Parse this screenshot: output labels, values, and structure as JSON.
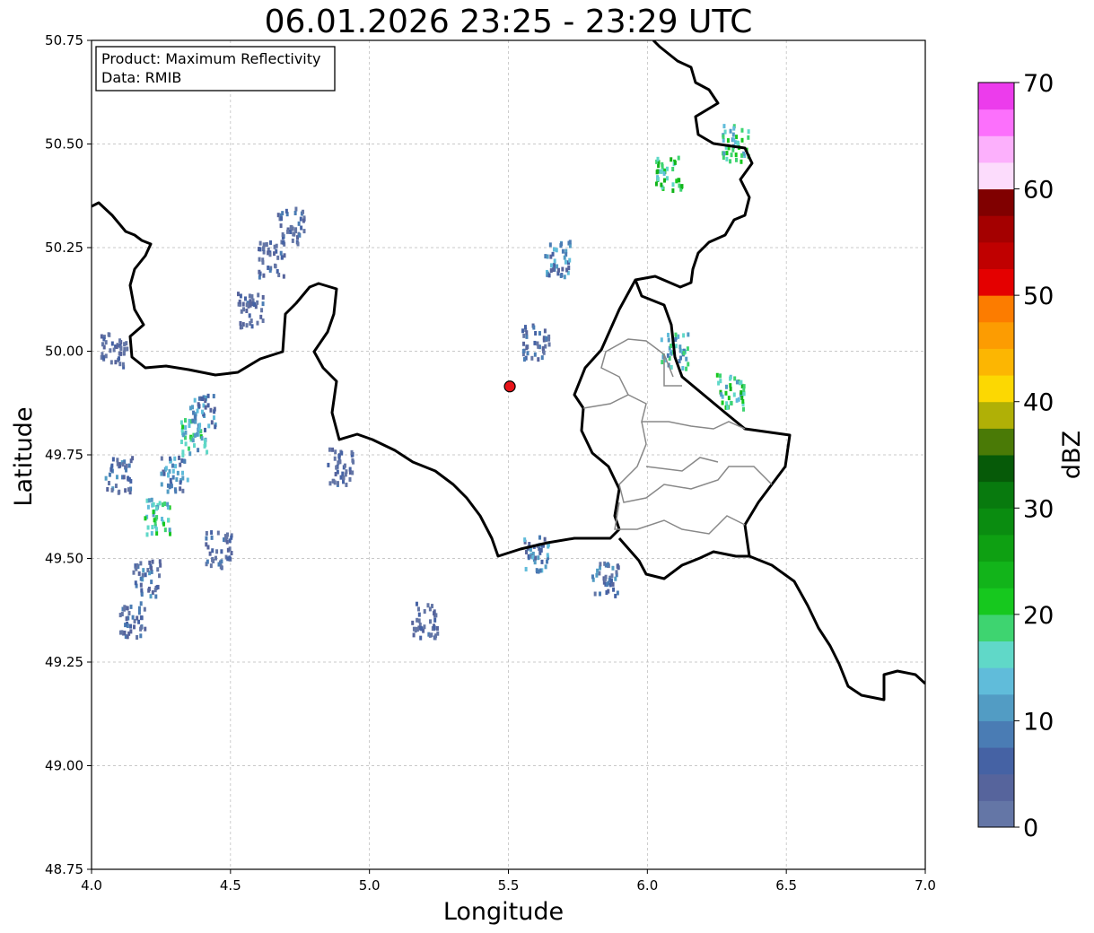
{
  "title": "06.01.2026 23:25 - 23:29 UTC",
  "info_box": {
    "product_line": "Product: Maximum Reflectivity",
    "data_line": "Data: RMIB"
  },
  "chart_data": {
    "type": "heatmap",
    "title": "06.01.2026 23:25 - 23:29 UTC",
    "xlabel": "Longitude",
    "ylabel": "Latitude",
    "xlim": [
      4.0,
      7.0
    ],
    "ylim": [
      48.75,
      50.75
    ],
    "x_ticks": [
      "4.0",
      "4.5",
      "5.0",
      "5.5",
      "6.0",
      "6.5",
      "7.0"
    ],
    "y_ticks": [
      "48.75",
      "49.00",
      "49.25",
      "49.50",
      "49.75",
      "50.00",
      "50.25",
      "50.50",
      "50.75"
    ],
    "grid": true,
    "radar_site": {
      "lon": 5.505,
      "lat": 49.915,
      "color": "#e8141a"
    },
    "colorbar": {
      "label": "dBZ",
      "min": 0,
      "max": 70,
      "ticks": [
        "0",
        "10",
        "20",
        "30",
        "40",
        "50",
        "60",
        "70"
      ],
      "colors": [
        "#6476a6",
        "#56649c",
        "#4562a4",
        "#4a7cb4",
        "#529cc4",
        "#60bcda",
        "#60d8c8",
        "#3ed470",
        "#16c81e",
        "#12b41a",
        "#0ea012",
        "#0a8c10",
        "#087a0e",
        "#065a08",
        "#4a7a06",
        "#b0b006",
        "#fcd802",
        "#fcb602",
        "#fc9c02",
        "#fc7c00",
        "#e40000",
        "#c00000",
        "#a40000",
        "#800000",
        "#fcdcfc",
        "#fcb0fc",
        "#fc70fc",
        "#ec3cec"
      ]
    },
    "echoes": [
      {
        "lon": 4.24,
        "lat": 49.6,
        "value": 22
      },
      {
        "lon": 4.37,
        "lat": 49.79,
        "value": 21
      },
      {
        "lon": 4.4,
        "lat": 49.85,
        "value": 15
      },
      {
        "lon": 4.3,
        "lat": 49.7,
        "value": 14
      },
      {
        "lon": 4.2,
        "lat": 49.45,
        "value": 12
      },
      {
        "lon": 4.15,
        "lat": 49.35,
        "value": 10
      },
      {
        "lon": 4.1,
        "lat": 49.7,
        "value": 11
      },
      {
        "lon": 4.46,
        "lat": 49.52,
        "value": 9
      },
      {
        "lon": 4.72,
        "lat": 50.3,
        "value": 9
      },
      {
        "lon": 4.65,
        "lat": 50.22,
        "value": 8
      },
      {
        "lon": 4.57,
        "lat": 50.1,
        "value": 8
      },
      {
        "lon": 5.6,
        "lat": 50.02,
        "value": 10
      },
      {
        "lon": 5.68,
        "lat": 50.22,
        "value": 15
      },
      {
        "lon": 6.08,
        "lat": 50.43,
        "value": 25
      },
      {
        "lon": 6.32,
        "lat": 50.5,
        "value": 22
      },
      {
        "lon": 6.1,
        "lat": 50.0,
        "value": 20
      },
      {
        "lon": 6.3,
        "lat": 49.9,
        "value": 24
      },
      {
        "lon": 5.6,
        "lat": 49.51,
        "value": 14
      },
      {
        "lon": 5.85,
        "lat": 49.45,
        "value": 12
      },
      {
        "lon": 4.9,
        "lat": 49.72,
        "value": 8
      },
      {
        "lon": 4.08,
        "lat": 50.0,
        "value": 6
      },
      {
        "lon": 5.2,
        "lat": 49.35,
        "value": 8
      }
    ]
  }
}
